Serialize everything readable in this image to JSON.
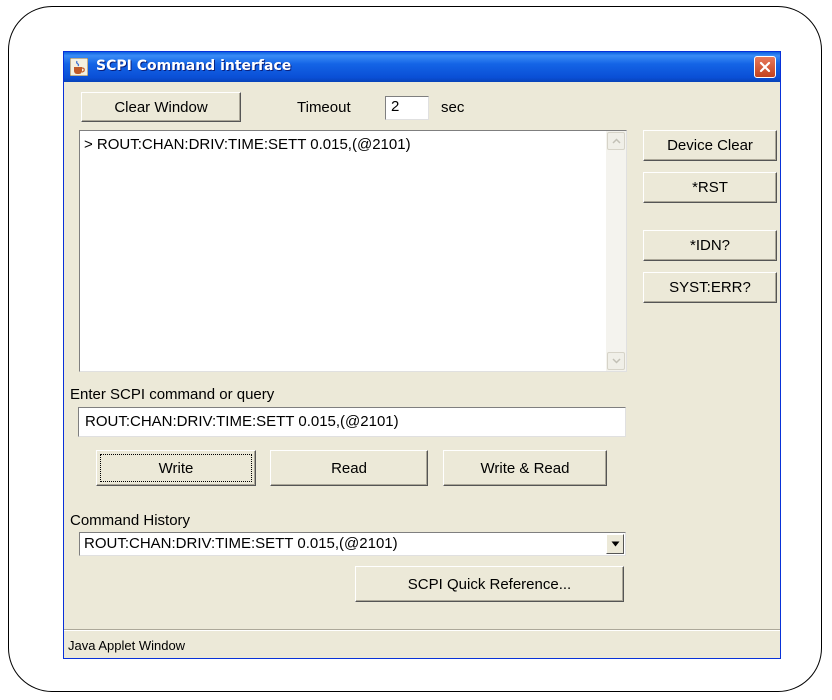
{
  "window": {
    "title": "SCPI Command interface",
    "status": "Java Applet Window"
  },
  "toolbar": {
    "clear_window_label": "Clear Window",
    "timeout_label": "Timeout",
    "timeout_value": "2",
    "timeout_unit": "sec"
  },
  "output": {
    "lines": [
      "> ROUT:CHAN:DRIV:TIME:SETT 0.015,(@2101)"
    ]
  },
  "side_buttons": {
    "device_clear": "Device Clear",
    "rst": "*RST",
    "idn": "*IDN?",
    "syst_err": "SYST:ERR?"
  },
  "command": {
    "label": "Enter SCPI command or query",
    "value": "ROUT:CHAN:DRIV:TIME:SETT 0.015,(@2101)",
    "write_label": "Write",
    "read_label": "Read",
    "write_read_label": "Write & Read"
  },
  "history": {
    "label": "Command History",
    "selected": "ROUT:CHAN:DRIV:TIME:SETT 0.015,(@2101)",
    "quick_reference_label": "SCPI Quick Reference..."
  },
  "icons": {
    "app": "java-cup-icon",
    "close": "close-icon",
    "scroll_up": "scroll-up-arrow-icon",
    "scroll_down": "scroll-down-arrow-icon",
    "dropdown": "chevron-down-icon"
  },
  "colors": {
    "titlebar": "#0a4fd6",
    "window_bg": "#ece9d8",
    "close_button": "#c3421f"
  }
}
